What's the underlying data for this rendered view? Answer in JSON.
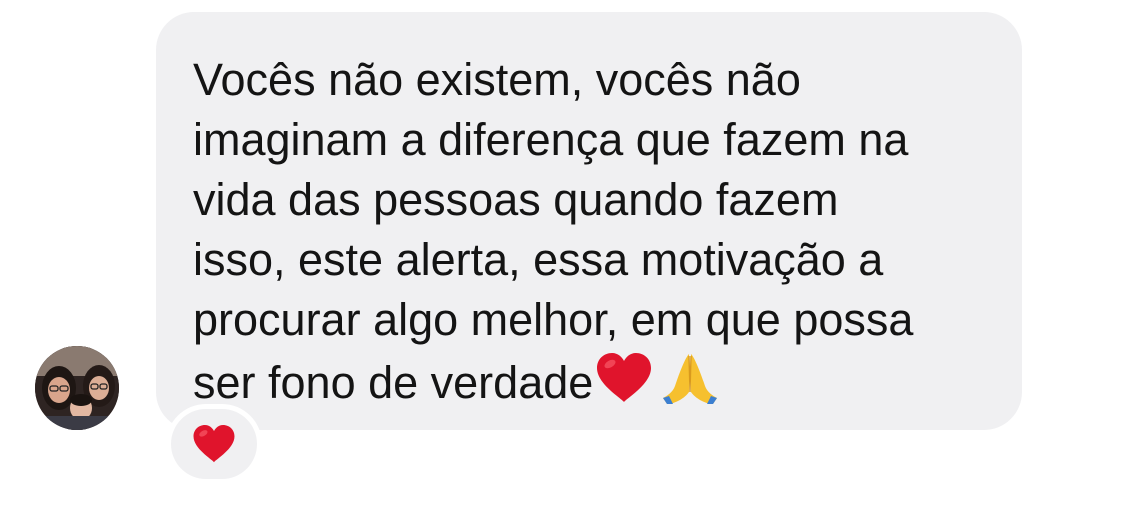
{
  "message": {
    "lines": [
      "Vocês não existem, vocês não",
      "imaginam a diferença que fazem na",
      "vida das pessoas quando fazem",
      "isso, este alerta, essa motivação a",
      "procurar algo melhor, em que possa",
      "ser fono de verdade"
    ],
    "trailing_emojis": [
      "red-heart-emoji",
      "folded-hands-emoji"
    ]
  },
  "reaction": {
    "emoji": "red-heart-emoji"
  },
  "colors": {
    "bubble_background": "#f0f0f2",
    "text": "#141414",
    "heart": "#e0142c"
  }
}
